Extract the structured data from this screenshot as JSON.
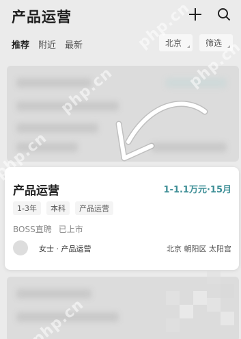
{
  "header": {
    "title": "产品运营",
    "add_icon": "plus-icon",
    "search_icon": "search-icon"
  },
  "tabs": [
    {
      "label": "推荐",
      "active": true
    },
    {
      "label": "附近",
      "active": false
    },
    {
      "label": "最新",
      "active": false
    }
  ],
  "filters": {
    "city": "北京",
    "filter": "筛选"
  },
  "job": {
    "title": "产品运营",
    "salary": "1-1.1万元·15月",
    "tags": [
      "1-3年",
      "本科",
      "产品运营"
    ],
    "company": "BOSS直聘",
    "stage": "已上市",
    "recruiter": "女士 · 产品运营",
    "location": "北京 朝阳区 太阳宫"
  },
  "watermark": "php.cn",
  "colors": {
    "accent": "#3d8e96",
    "background": "#ebebeb",
    "card": "#ffffff"
  }
}
